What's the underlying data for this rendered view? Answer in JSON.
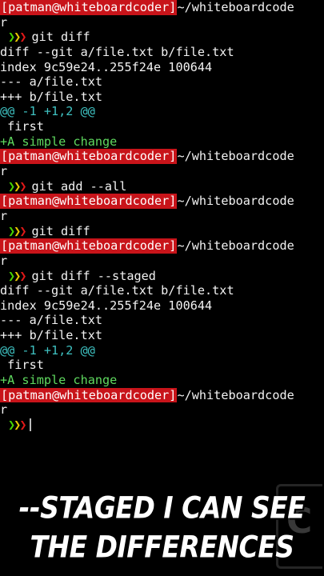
{
  "prompt": {
    "user_host": "[patman@whiteboardcoder]",
    "path_part1": "~/whiteboardcode",
    "path_part2": "r",
    "arrows": "❯❯❯"
  },
  "commands": {
    "diff1": "git diff",
    "add": "git add --all",
    "diff2": "git diff",
    "staged": "git diff --staged"
  },
  "diff_output_1": {
    "header": "diff --git a/file.txt b/file.txt",
    "index": "index 9c59e24..255f24e 100644",
    "minus_file": "--- a/file.txt",
    "plus_file": "+++ b/file.txt",
    "hunk": "@@ -1 +1,2 @@",
    "context": " first",
    "added": "+A simple change"
  },
  "diff_output_2": {
    "header": "diff --git a/file.txt b/file.txt",
    "index": "index 9c59e24..255f24e 100644",
    "minus_file": "--- a/file.txt",
    "plus_file": "+++ b/file.txt",
    "hunk": "@@ -1 +1,2 @@",
    "context": " first",
    "added": "+A simple change"
  },
  "caption": {
    "line1": "--STAGED I CAN SEE",
    "line2": "THE DIFFERENCES"
  },
  "logo": {
    "icon": "whiteboardcoder-logo-icon",
    "text": "C"
  },
  "colors": {
    "prompt_bg": "#c8141a",
    "arrow1": "#46d400",
    "arrow2": "#e6c800",
    "arrow3": "#e01818",
    "hunk": "#3ec0c0",
    "added": "#5fd95f"
  }
}
